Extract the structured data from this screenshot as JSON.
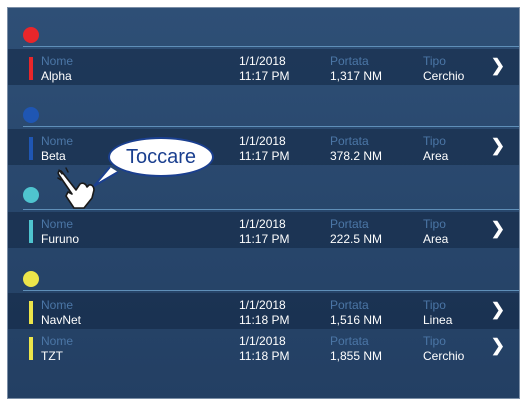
{
  "colors": {
    "background": "#284870",
    "red": "#e8262a",
    "blue": "#1f56b3",
    "cyan": "#4fc4cf",
    "yellow": "#ece54a",
    "label": "#4b76a6",
    "callout_border": "#1a3f8f"
  },
  "groups": [
    {
      "color_name": "red",
      "rows": [
        {
          "name_label": "Nome",
          "name": "Alpha",
          "date": "1/1/2018",
          "time": "11:17 PM",
          "range_label": "Portata",
          "range": "1,317 NM",
          "type_label": "Tipo",
          "type": "Cerchio"
        }
      ]
    },
    {
      "color_name": "blue",
      "rows": [
        {
          "name_label": "Nome",
          "name": "Beta",
          "date": "1/1/2018",
          "time": "11:17 PM",
          "range_label": "Portata",
          "range": "378.2 NM",
          "type_label": "Tipo",
          "type": "Area"
        }
      ]
    },
    {
      "color_name": "cyan",
      "rows": [
        {
          "name_label": "Nome",
          "name": "Furuno",
          "date": "1/1/2018",
          "time": "11:17 PM",
          "range_label": "Portata",
          "range": "222.5 NM",
          "type_label": "Tipo",
          "type": "Area"
        }
      ]
    },
    {
      "color_name": "yellow",
      "rows": [
        {
          "name_label": "Nome",
          "name": "NavNet",
          "date": "1/1/2018",
          "time": "11:18 PM",
          "range_label": "Portata",
          "range": "1,516 NM",
          "type_label": "Tipo",
          "type": "Linea"
        },
        {
          "name_label": "Nome",
          "name": "TZT",
          "date": "1/1/2018",
          "time": "11:18 PM",
          "range_label": "Portata",
          "range": "1,855 NM",
          "type_label": "Tipo",
          "type": "Cerchio"
        }
      ]
    }
  ],
  "callout": {
    "text": "Toccare"
  },
  "icons": {
    "chevron": "chevron-right-icon",
    "hand": "pointing-hand-icon"
  }
}
